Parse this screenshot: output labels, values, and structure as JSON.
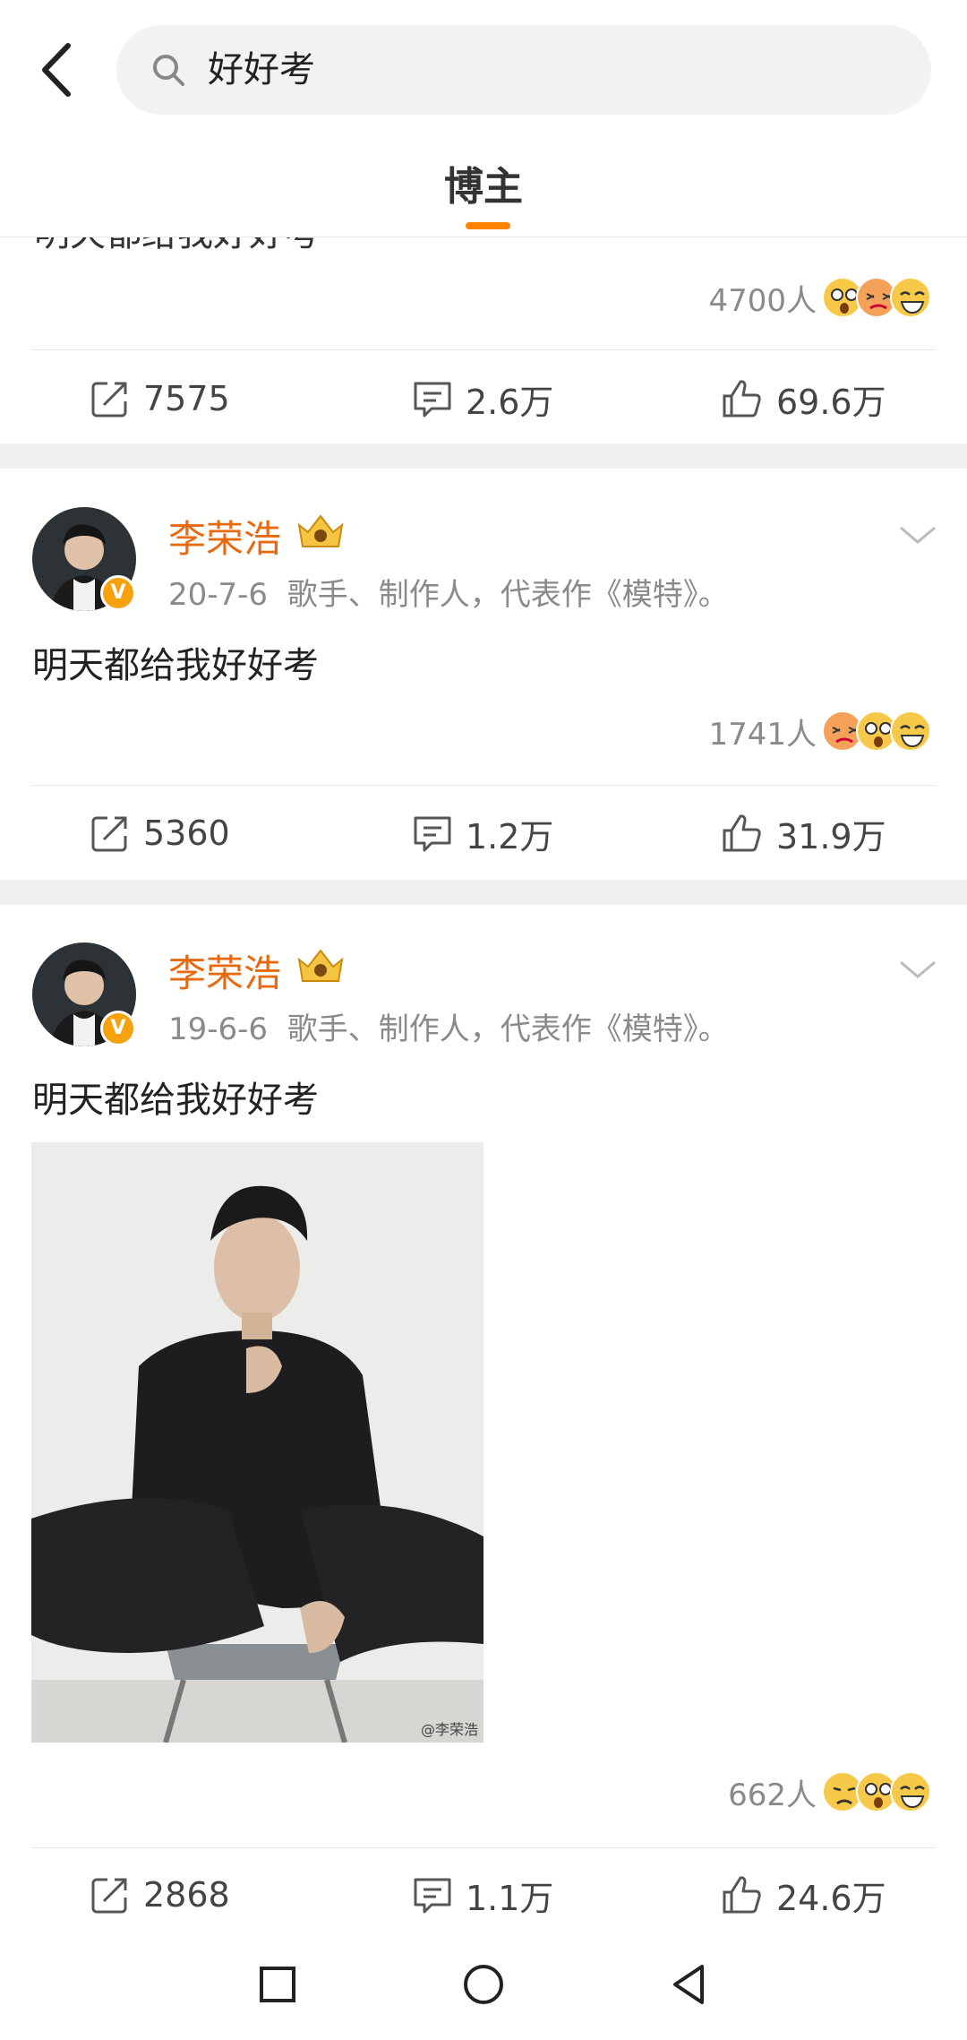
{
  "search": {
    "query": "好好考"
  },
  "tab": {
    "label": "博主"
  },
  "previous_post": {
    "cut_text": "明天都给我好好考",
    "reaction_count": "4700人",
    "repost": "7575",
    "comment": "2.6万",
    "like": "69.6万"
  },
  "posts": [
    {
      "username": "李荣浩",
      "date": "20-7-6",
      "bio": "歌手、制作人，代表作《模特》。",
      "text": "明天都给我好好考",
      "reaction_count": "1741人",
      "repost": "5360",
      "comment": "1.2万",
      "like": "31.9万"
    },
    {
      "username": "李荣浩",
      "date": "19-6-6",
      "bio": "歌手、制作人，代表作《模特》。",
      "text": "明天都给我好好考",
      "watermark": "@李荣浩",
      "reaction_count": "662人",
      "repost": "2868",
      "comment": "1.1万",
      "like": "24.6万"
    }
  ],
  "colors": {
    "accent": "#ff8200",
    "username": "#e86a10",
    "muted": "#8a8a8a"
  },
  "icons": [
    "back-arrow-icon",
    "search-icon",
    "repost-icon",
    "comment-icon",
    "like-icon",
    "crown-icon",
    "chevron-down-icon",
    "verified-icon",
    "home-icon",
    "recent-apps-icon",
    "nav-back-icon"
  ]
}
